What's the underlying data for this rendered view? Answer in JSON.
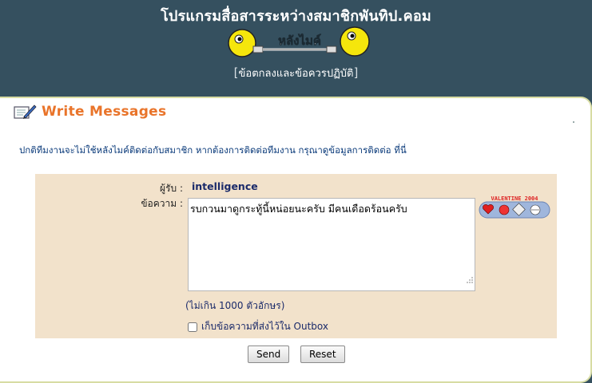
{
  "header": {
    "site_title": "โปรแกรมสื่อสารระหว่างสมาชิกพันทิป.คอม",
    "logo_text": "หลังไมค์",
    "terms_link": "ข้อตกลงและข้อควรปฏิบัติ"
  },
  "panel": {
    "title": "Write Messages",
    "notice": "ปกติทีมงานจะไม่ใช้หลังไมค์ติดต่อกับสมาชิก หากต้องการติดต่อทีมงาน กรุณาดูข้อมูลการติดต่อ",
    "notice_link": "ที่นี่"
  },
  "form": {
    "recipient_label": "ผู้รับ :",
    "recipient_value": "intelligence",
    "message_label": "ข้อความ :",
    "message_value": "รบกวนมาดูกระทู้นี้หน่อยนะครับ มีคนเดือดร้อนครับ",
    "limit_note": "(ไม่เกิน 1000 ตัวอักษร)",
    "save_outbox_label": "เก็บข้อความที่ส่งไว้ใน Outbox",
    "save_outbox_checked": false,
    "valentine_badge": "VALENTINE 2004"
  },
  "buttons": {
    "send": "Send",
    "reset": "Reset"
  },
  "colors": {
    "header_bg": "#35505f",
    "form_bg": "#f2e2cb",
    "title_accent": "#e9742a",
    "link_blue": "#0a3a7a"
  }
}
